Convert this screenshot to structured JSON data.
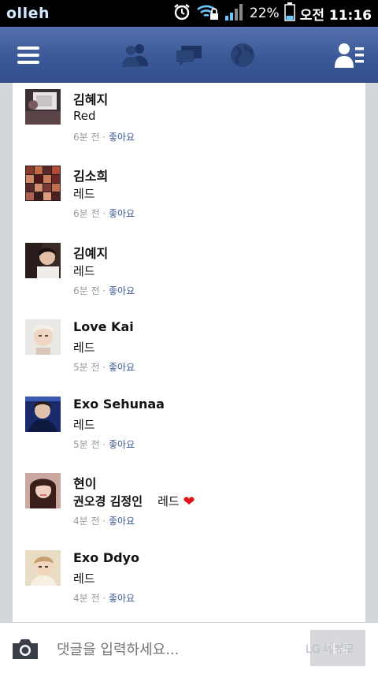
{
  "status_bar": {
    "carrier": "olleh",
    "battery_percent": "22%",
    "clock": "오전 11:16",
    "icons": [
      "alarm-clock-icon",
      "wifi-lock-icon",
      "signal-icon",
      "battery-icon"
    ]
  },
  "top_bar": {
    "icons": [
      "menu-icon",
      "friends-icon",
      "messages-icon",
      "notifications-globe-icon",
      "contacts-icon"
    ]
  },
  "comments": [
    {
      "name": "김혜지",
      "text": "Red",
      "time": "6분 전",
      "like": "좋아요"
    },
    {
      "name": "김소희",
      "text": "레드",
      "time": "6분 전",
      "like": "좋아요"
    },
    {
      "name": "김예지",
      "text": "레드",
      "time": "6분 전",
      "like": "좋아요"
    },
    {
      "name": "Love Kai",
      "text": "레드",
      "time": "5분 전",
      "like": "좋아요"
    },
    {
      "name": "Exo Sehunaa",
      "text": "레드",
      "time": "5분 전",
      "like": "좋아요"
    },
    {
      "name": "현이",
      "tag": "권오경 김정인",
      "text": "레드",
      "emoji": "❤",
      "time": "4분 전",
      "like": "좋아요"
    },
    {
      "name": "Exo Ddyo",
      "text": "레드",
      "time": "4분 전",
      "like": "좋아요"
    }
  ],
  "meta_separator": "·",
  "input_bar": {
    "placeholder": "댓글을 입력하세요...",
    "post_label": "게시",
    "watermark": "LG 네뷰모"
  },
  "colors": {
    "brand": "#3b5998",
    "heart": "#e0141e"
  }
}
